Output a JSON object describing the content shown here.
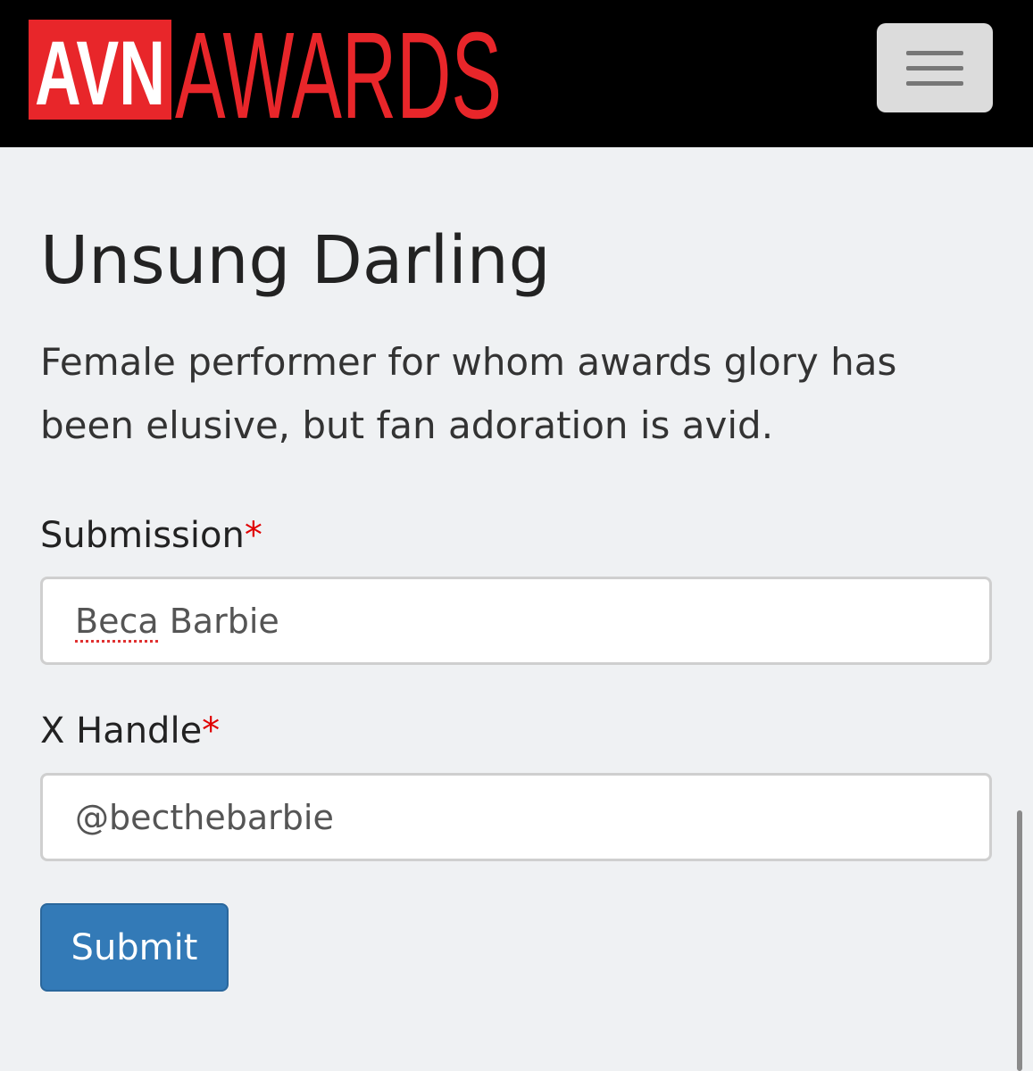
{
  "header": {
    "logo_avn": "AVN",
    "logo_awards": "AWARDS",
    "menu_icon": "hamburger-menu-icon"
  },
  "category": {
    "title": "Unsung Darling",
    "description": "Female performer for whom awards glory has been elusive, but fan adoration is avid."
  },
  "form": {
    "fields": [
      {
        "label": "Submission",
        "required_mark": "*",
        "value_first": "Beca",
        "value_rest": " Barbie"
      },
      {
        "label": "X Handle",
        "required_mark": "*",
        "value": "@becthebarbie"
      }
    ],
    "submit_label": "Submit"
  },
  "colors": {
    "header_bg": "#000000",
    "logo_red": "#e8262a",
    "page_bg": "#eff1f3",
    "required_red": "#e00000",
    "button_blue": "#337ab7"
  }
}
